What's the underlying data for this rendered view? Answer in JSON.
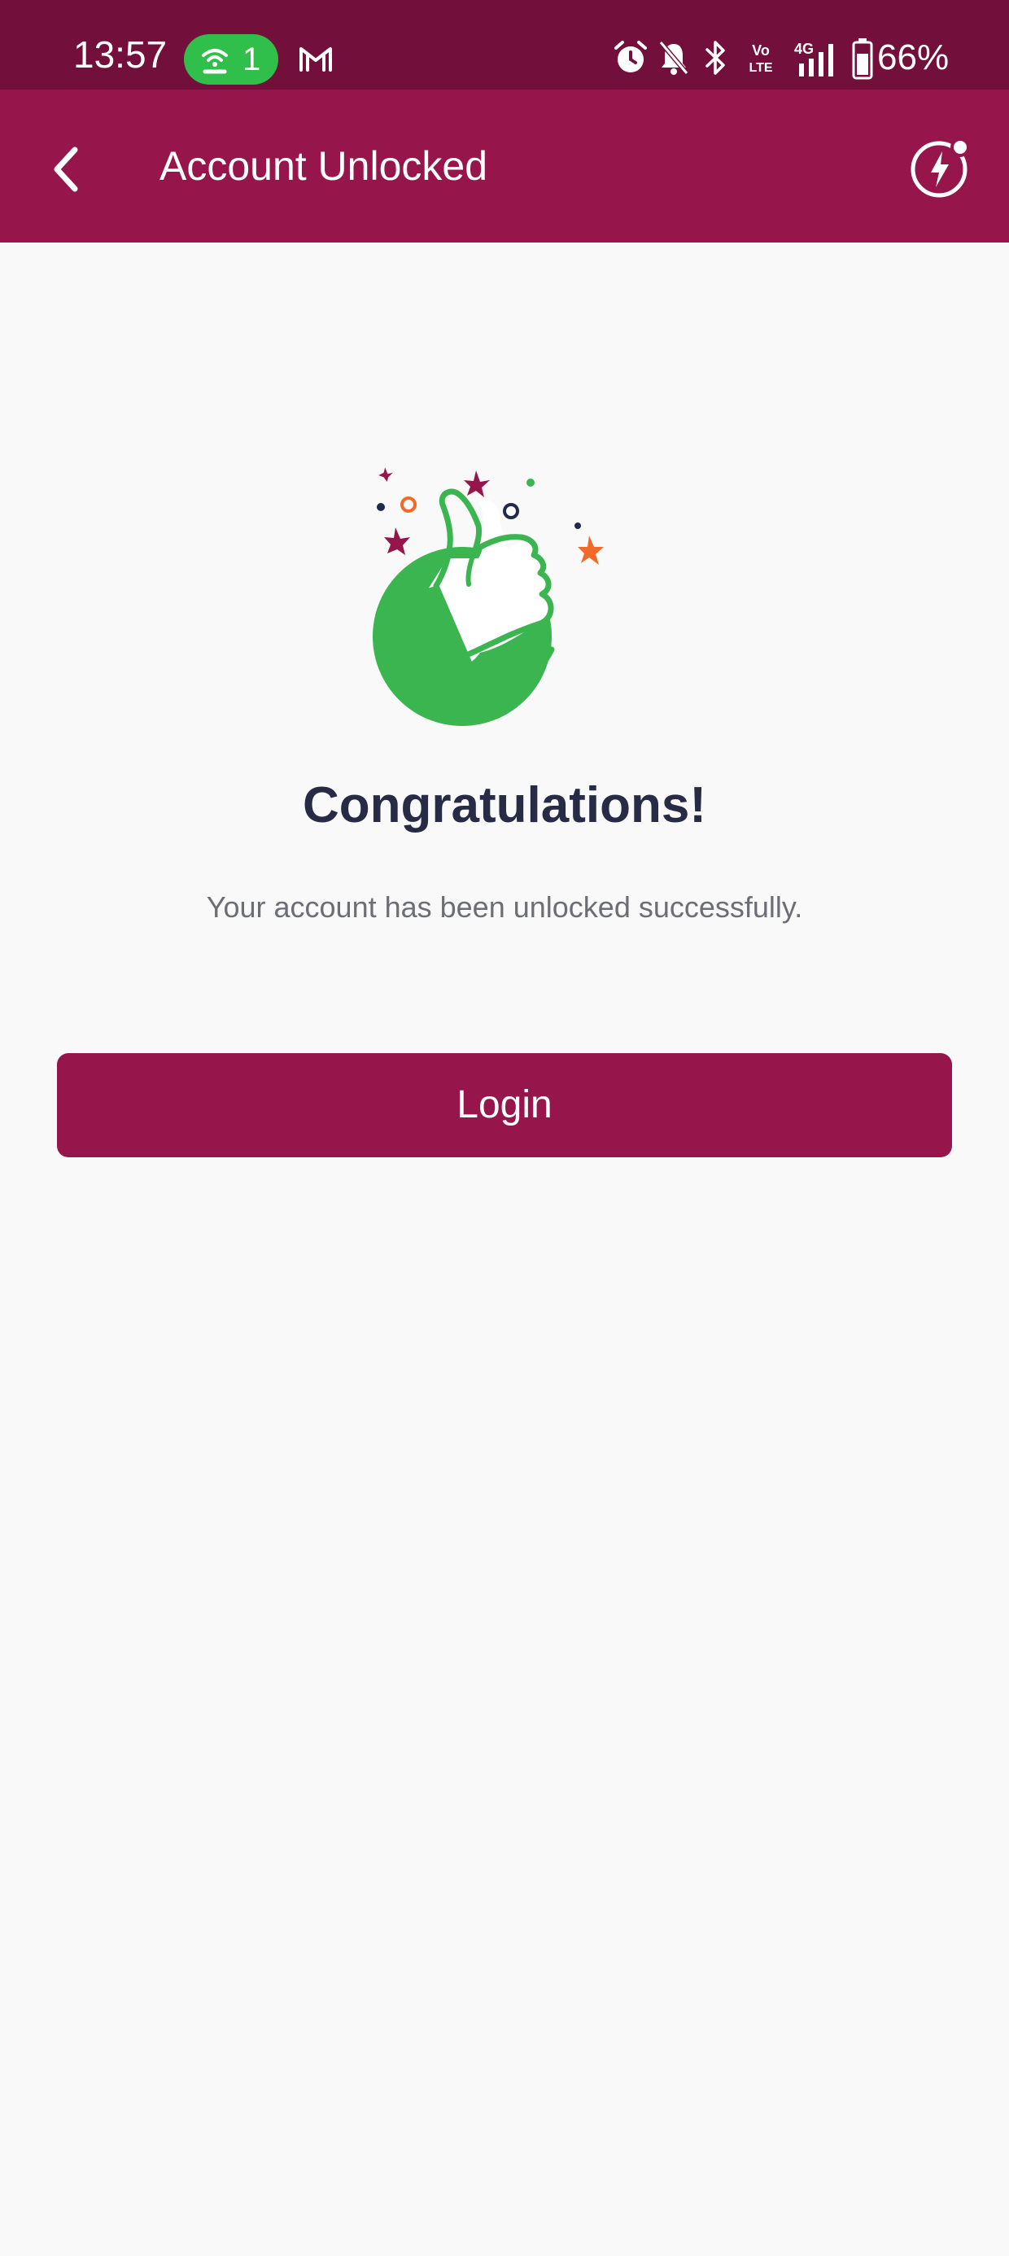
{
  "status_bar": {
    "time": "13:57",
    "hotspot_count": "1",
    "battery": "66%",
    "background": "#72103b",
    "icons": [
      "hotspot-icon",
      "gmail-icon",
      "alarm-icon",
      "bell-muted-icon",
      "bluetooth-icon",
      "volte-icon",
      "signal-4g-icon",
      "battery-icon"
    ]
  },
  "app_bar": {
    "title": "Account Unlocked",
    "background": "#96154b",
    "icons": [
      "back-arrow-icon",
      "lightning-icon"
    ]
  },
  "content": {
    "illustration": "thumbs-up-celebration-icon",
    "heading": "Congratulations!",
    "message": "Your account has been unlocked successfully.",
    "login_label": "Login"
  },
  "colors": {
    "accent": "#96154b",
    "success_green": "#3bb54f",
    "heading_text": "#272b45",
    "body_text": "#6d6e75",
    "confetti_orange": "#f26a2a",
    "confetti_navy": "#1f2a4c",
    "page_background": "#f9f9f9"
  }
}
